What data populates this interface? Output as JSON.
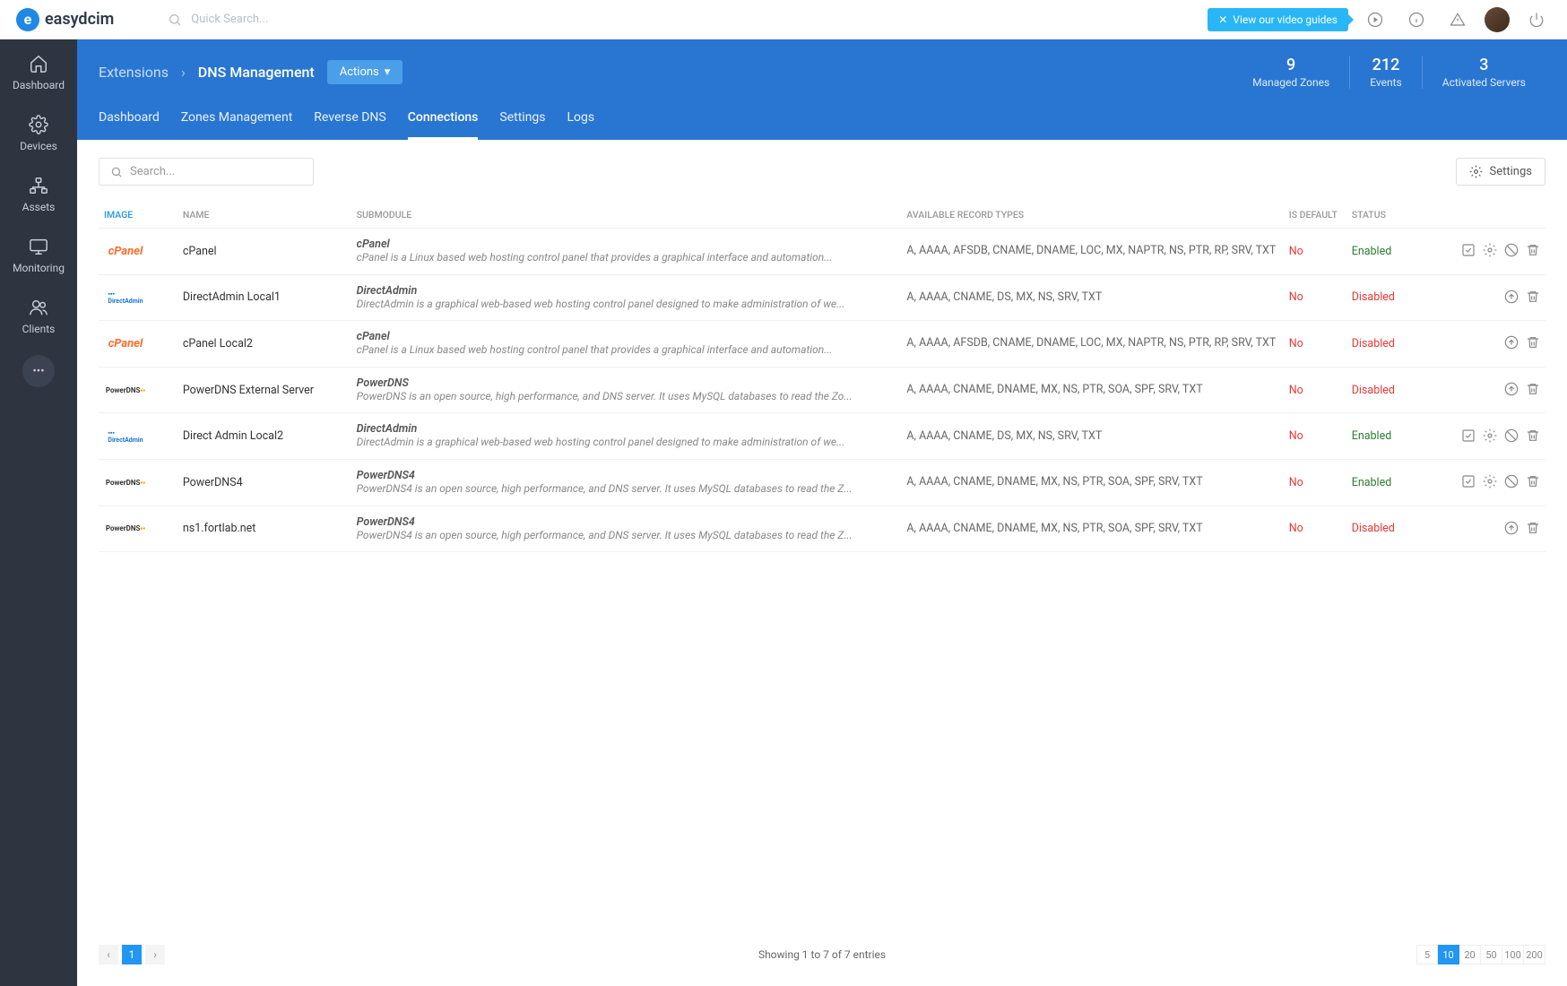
{
  "app_name": "easydcim",
  "topbar": {
    "search_placeholder": "Quick Search...",
    "video_guides": "View our video guides"
  },
  "sidebar": {
    "items": [
      {
        "label": "Dashboard"
      },
      {
        "label": "Devices"
      },
      {
        "label": "Assets"
      },
      {
        "label": "Monitoring"
      },
      {
        "label": "Clients"
      }
    ]
  },
  "breadcrumb": {
    "first": "Extensions",
    "current": "DNS Management",
    "actions": "Actions"
  },
  "stats": [
    {
      "num": "9",
      "label": "Managed Zones"
    },
    {
      "num": "212",
      "label": "Events"
    },
    {
      "num": "3",
      "label": "Activated Servers"
    }
  ],
  "tabs": [
    {
      "label": "Dashboard",
      "active": false
    },
    {
      "label": "Zones Management",
      "active": false
    },
    {
      "label": "Reverse DNS",
      "active": false
    },
    {
      "label": "Connections",
      "active": true
    },
    {
      "label": "Settings",
      "active": false
    },
    {
      "label": "Logs",
      "active": false
    }
  ],
  "toolbar": {
    "search_placeholder": "Search...",
    "settings": "Settings"
  },
  "columns": {
    "image": "IMAGE",
    "name": "NAME",
    "submodule": "SUBMODULE",
    "record_types": "AVAILABLE RECORD TYPES",
    "is_default": "IS DEFAULT",
    "status": "STATUS"
  },
  "rows": [
    {
      "img": "cpanel",
      "name": "cPanel",
      "sub_title": "cPanel",
      "sub_desc": "cPanel is a Linux based web hosting control panel that provides a graphical interface and automation...",
      "records": "A, AAAA, AFSDB, CNAME, DNAME, LOC, MX, NAPTR, NS, PTR, RP, SRV, TXT",
      "is_default": "No",
      "status": "Enabled",
      "actions": "enabled"
    },
    {
      "img": "directadmin",
      "name": "DirectAdmin Local1",
      "sub_title": "DirectAdmin",
      "sub_desc": "DirectAdmin is a graphical web-based web hosting control panel designed to make administration of we...",
      "records": "A, AAAA, CNAME, DS, MX, NS, SRV, TXT",
      "is_default": "No",
      "status": "Disabled",
      "actions": "disabled"
    },
    {
      "img": "cpanel",
      "name": "cPanel Local2",
      "sub_title": "cPanel",
      "sub_desc": "cPanel is a Linux based web hosting control panel that provides a graphical interface and automation...",
      "records": "A, AAAA, AFSDB, CNAME, DNAME, LOC, MX, NAPTR, NS, PTR, RP, SRV, TXT",
      "is_default": "No",
      "status": "Disabled",
      "actions": "disabled"
    },
    {
      "img": "powerdns",
      "name": "PowerDNS External Server",
      "sub_title": "PowerDNS",
      "sub_desc": "PowerDNS is an open source, high performance, and DNS server. It uses MySQL databases to read the Zo...",
      "records": "A, AAAA, CNAME, DNAME, MX, NS, PTR, SOA, SPF, SRV, TXT",
      "is_default": "No",
      "status": "Disabled",
      "actions": "disabled"
    },
    {
      "img": "directadmin",
      "name": "Direct Admin Local2",
      "sub_title": "DirectAdmin",
      "sub_desc": "DirectAdmin is a graphical web-based web hosting control panel designed to make administration of we...",
      "records": "A, AAAA, CNAME, DS, MX, NS, SRV, TXT",
      "is_default": "No",
      "status": "Enabled",
      "actions": "enabled"
    },
    {
      "img": "powerdns",
      "name": "PowerDNS4",
      "sub_title": "PowerDNS4",
      "sub_desc": "PowerDNS4 is an open source, high performance, and DNS server. It uses MySQL databases to read the Z...",
      "records": "A, AAAA, CNAME, DNAME, MX, NS, PTR, SOA, SPF, SRV, TXT",
      "is_default": "No",
      "status": "Enabled",
      "actions": "enabled"
    },
    {
      "img": "powerdns",
      "name": "ns1.fortlab.net",
      "sub_title": "PowerDNS4",
      "sub_desc": "PowerDNS4 is an open source, high performance, and DNS server. It uses MySQL databases to read the Z...",
      "records": "A, AAAA, CNAME, DNAME, MX, NS, PTR, SOA, SPF, SRV, TXT",
      "is_default": "No",
      "status": "Disabled",
      "actions": "disabled"
    }
  ],
  "footer": {
    "page": "1",
    "showing": "Showing 1 to 7 of 7 entries",
    "page_sizes": [
      "5",
      "10",
      "20",
      "50",
      "100",
      "200"
    ],
    "page_size_active": "10"
  }
}
